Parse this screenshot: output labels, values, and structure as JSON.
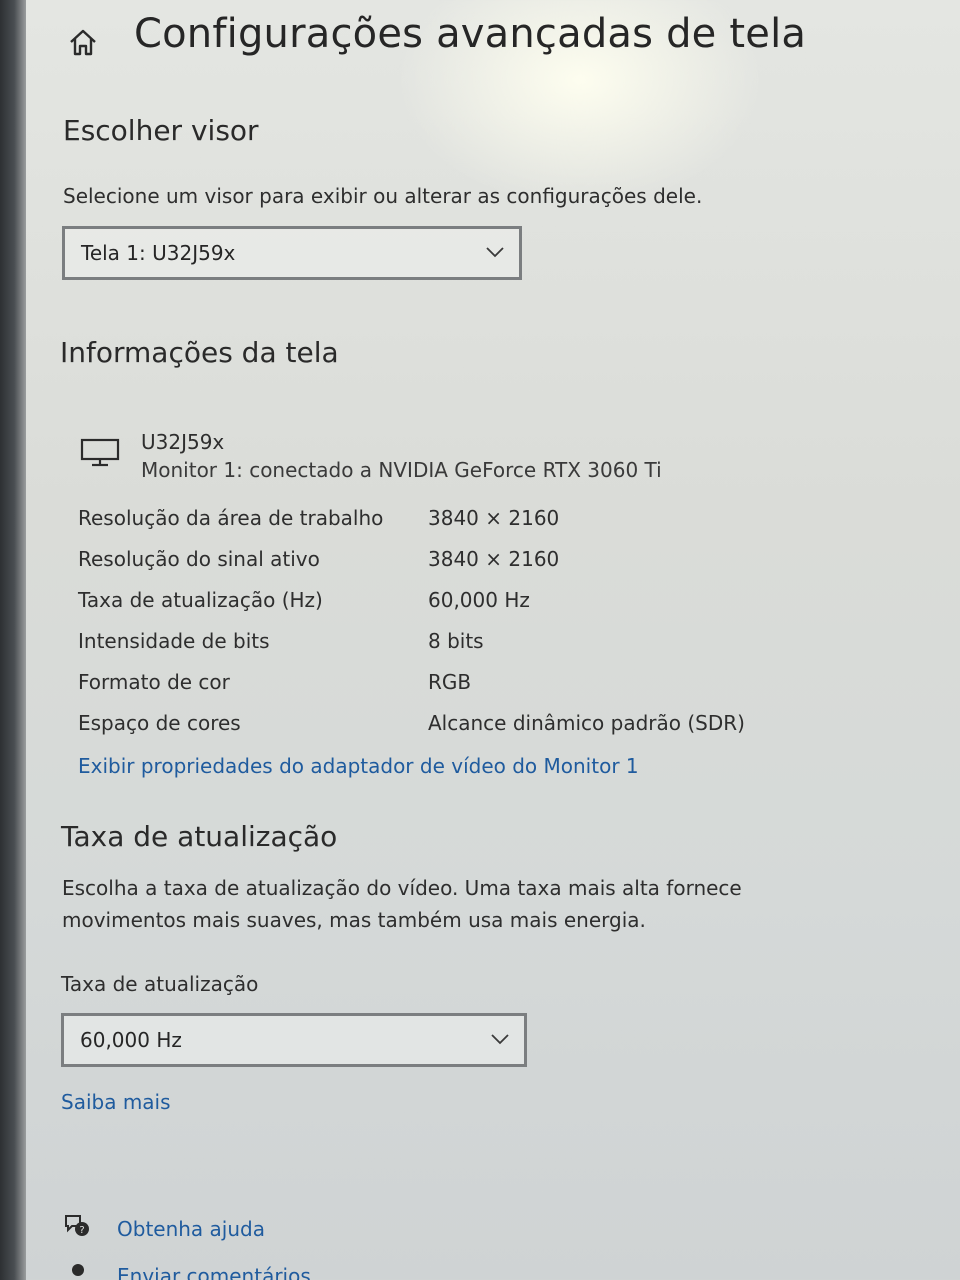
{
  "header": {
    "title": "Configurações avançadas de tela",
    "home_icon": "home-icon"
  },
  "choose_display": {
    "title": "Escolher visor",
    "description": "Selecione um visor para exibir ou alterar as configurações dele.",
    "selected": "Tela 1: U32J59x"
  },
  "display_info": {
    "title": "Informações da tela",
    "monitor_name": "U32J59x",
    "monitor_connection": "Monitor 1: conectado a NVIDIA GeForce RTX 3060 Ti",
    "rows": [
      {
        "label": "Resolução da área de trabalho",
        "value": "3840 × 2160"
      },
      {
        "label": "Resolução do sinal ativo",
        "value": "3840 × 2160"
      },
      {
        "label": "Taxa de atualização (Hz)",
        "value": "60,000 Hz"
      },
      {
        "label": "Intensidade de bits",
        "value": "8 bits"
      },
      {
        "label": "Formato de cor",
        "value": "RGB"
      },
      {
        "label": "Espaço de cores",
        "value": "Alcance dinâmico padrão (SDR)"
      }
    ],
    "adapter_link": "Exibir propriedades do adaptador de vídeo do Monitor 1"
  },
  "refresh_rate": {
    "title": "Taxa de atualização",
    "description_line1": "Escolha a taxa de atualização do vídeo. Uma taxa mais alta fornece",
    "description_line2": "movimentos mais suaves, mas também usa mais energia.",
    "field_label": "Taxa de atualização",
    "selected": "60,000 Hz",
    "learn_more": "Saiba mais"
  },
  "footer": {
    "get_help": "Obtenha ajuda",
    "feedback": "Enviar comentários"
  },
  "colors": {
    "link": "#1f5b9e",
    "text": "#2e2e2e",
    "dropdown_border": "#7b7e80"
  }
}
